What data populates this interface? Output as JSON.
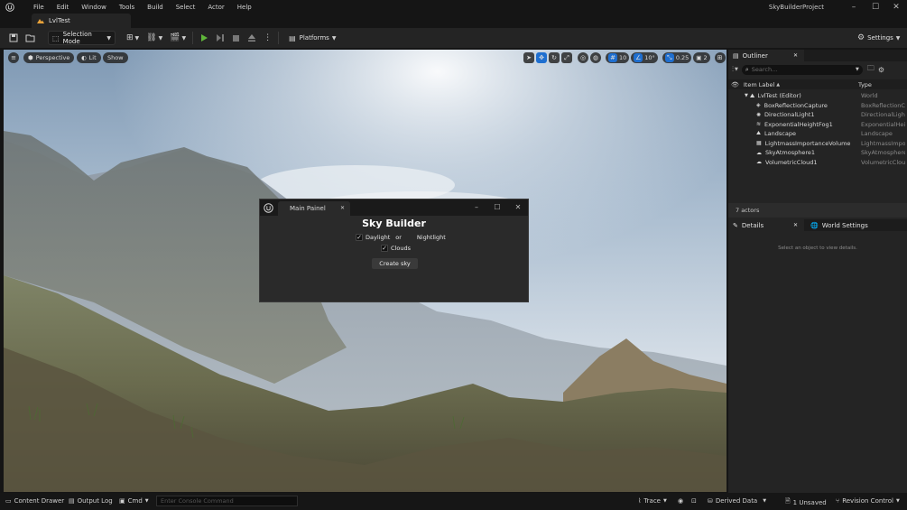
{
  "app": {
    "project_name": "SkyBuilderProject",
    "level_tab": "LvlTest"
  },
  "menu": [
    "File",
    "Edit",
    "Window",
    "Tools",
    "Build",
    "Select",
    "Actor",
    "Help"
  ],
  "toolbar": {
    "mode_label": "Selection Mode",
    "platforms_label": "Platforms",
    "settings_label": "Settings"
  },
  "viewport": {
    "perspective_label": "Perspective",
    "lit_label": "Lit",
    "show_label": "Show",
    "grid_value": "10",
    "rotation_value": "10°",
    "scale_value": "0.25",
    "camera_speed": "2"
  },
  "dialog": {
    "tab_label": "Main Painel",
    "title": "Sky Builder",
    "daylight_label": "Daylight",
    "or_label": "or",
    "nightlight_label": "Nightlight",
    "clouds_label": "Clouds",
    "create_button": "Create sky",
    "daylight_checked": true,
    "nightlight_checked": false,
    "clouds_checked": true
  },
  "outliner": {
    "tab_label": "Outliner",
    "search_placeholder": "Search...",
    "col_label": "Item Label",
    "col_type": "Type",
    "root": {
      "label": "LvlTest (Editor)",
      "type": "World"
    },
    "items": [
      {
        "label": "BoxReflectionCapture",
        "type": "BoxReflectionCa"
      },
      {
        "label": "DirectionalLight1",
        "type": "DirectionalLight"
      },
      {
        "label": "ExponentialHeightFog1",
        "type": "ExponentialHeig"
      },
      {
        "label": "Landscape",
        "type": "Landscape"
      },
      {
        "label": "LightmassImportanceVolume",
        "type": "LightmassImpor"
      },
      {
        "label": "SkyAtmosphere1",
        "type": "SkyAtmosphere"
      },
      {
        "label": "VolumetricCloud1",
        "type": "VolumetricCloud"
      }
    ],
    "actor_count": "7 actors"
  },
  "details": {
    "tab_label": "Details",
    "world_settings_label": "World Settings",
    "empty_message": "Select an object to view details."
  },
  "statusbar": {
    "content_drawer": "Content Drawer",
    "output_log": "Output Log",
    "cmd": "Cmd",
    "console_placeholder": "Enter Console Command",
    "trace": "Trace",
    "derived_data": "Derived Data",
    "unsaved": "1 Unsaved",
    "revision_control": "Revision Control"
  },
  "colors": {
    "accent_blue": "#1f6fd0",
    "play_green": "#5fb63a",
    "panel_bg": "#242424"
  }
}
